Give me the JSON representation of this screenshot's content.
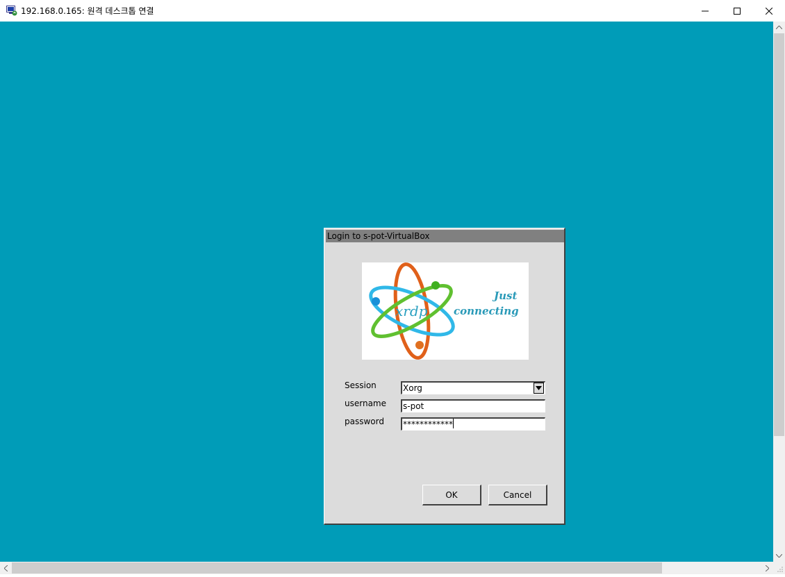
{
  "window": {
    "title": "192.168.0.165: 원격 데스크톱 연결",
    "icon": "remote-desktop-icon",
    "controls": [
      "minimize-icon",
      "maximize-icon",
      "close-icon"
    ]
  },
  "desktop": {
    "background_color": "#009cb8"
  },
  "dialog": {
    "title": "Login to s-pot-VirtualBox",
    "logo": {
      "text_line1": "Just",
      "text_line2": "connecting",
      "brand": "xrdp"
    },
    "fields": {
      "session_label": "Session",
      "session_value": "Xorg",
      "username_label": "username",
      "username_value": "s-pot",
      "password_label": "password",
      "password_value": "************"
    },
    "buttons": {
      "ok_label": "OK",
      "cancel_label": "Cancel"
    }
  }
}
